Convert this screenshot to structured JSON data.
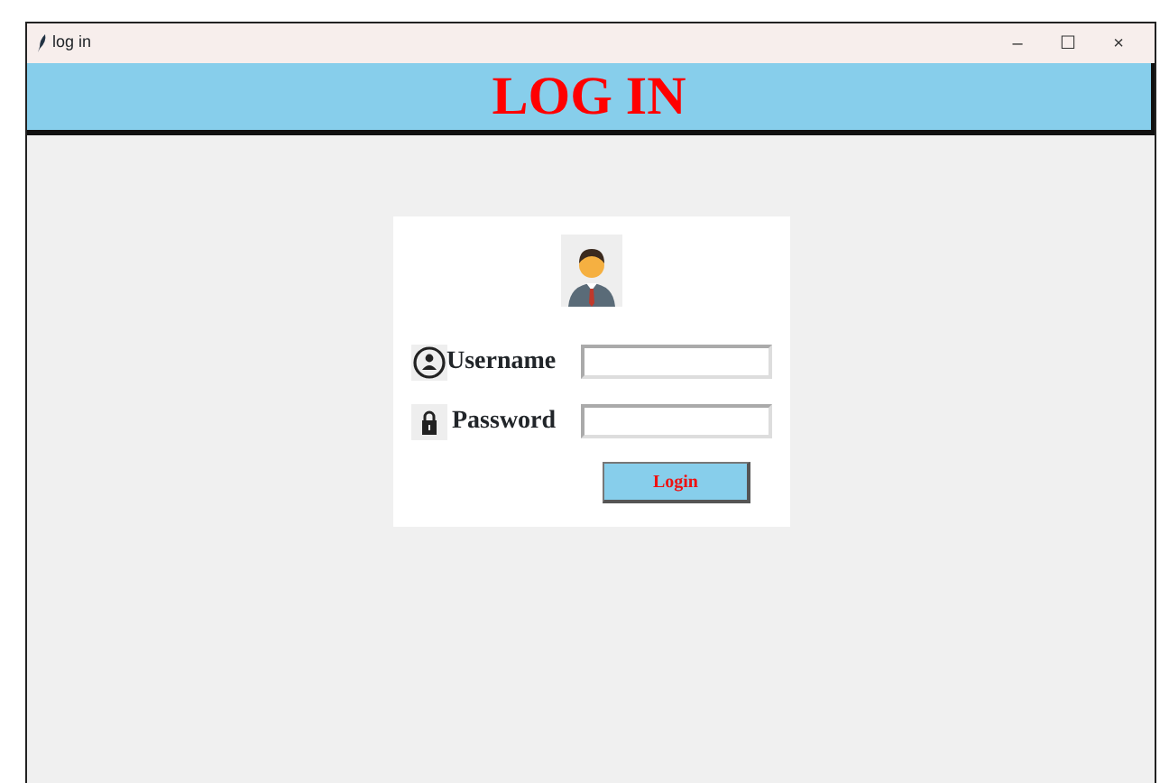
{
  "window": {
    "title": "log in",
    "controls": [
      "–",
      "☐",
      "×"
    ]
  },
  "header": {
    "title": "LOG IN"
  },
  "form": {
    "fields": [
      {
        "kind": "user",
        "label": "Username"
      },
      {
        "kind": "lock",
        "label": "Password"
      }
    ],
    "button": "Login"
  }
}
